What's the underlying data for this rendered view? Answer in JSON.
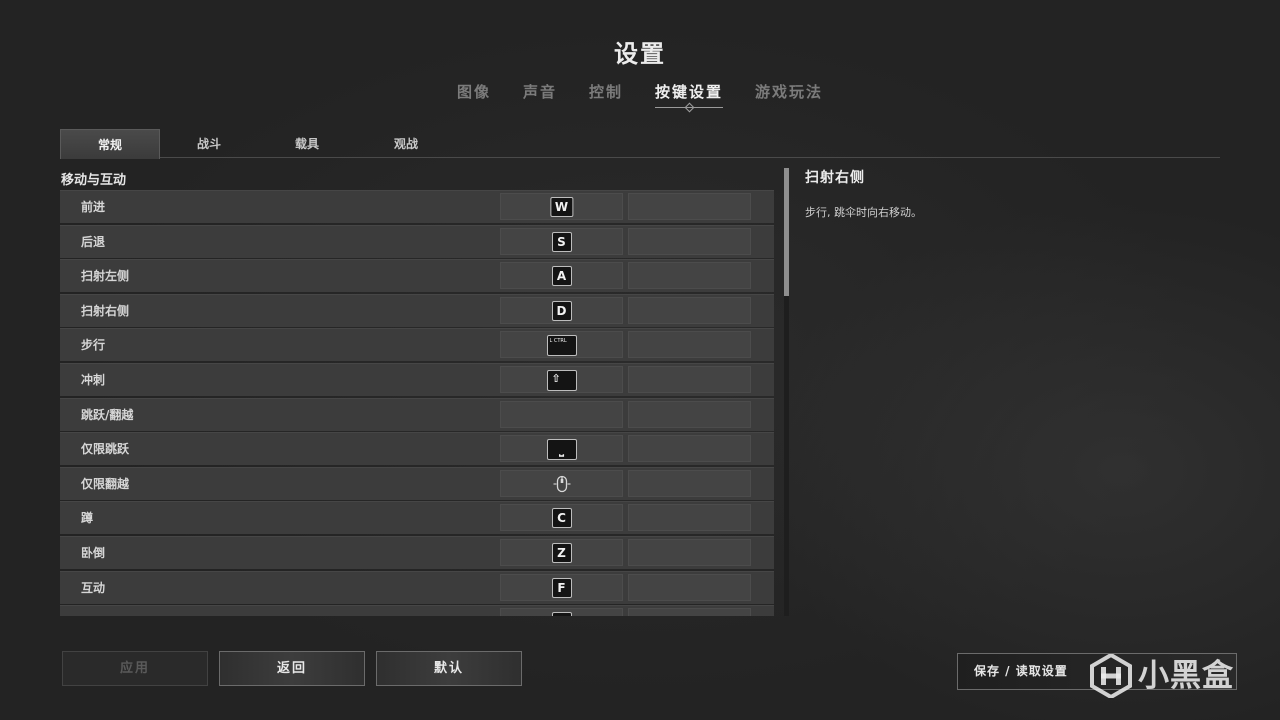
{
  "header": {
    "title": "设置",
    "tabs": [
      {
        "label": "图像",
        "active": false
      },
      {
        "label": "声音",
        "active": false
      },
      {
        "label": "控制",
        "active": false
      },
      {
        "label": "按键设置",
        "active": true
      },
      {
        "label": "游戏玩法",
        "active": false
      }
    ]
  },
  "sub_tabs": [
    {
      "label": "常规",
      "active": true
    },
    {
      "label": "战斗",
      "active": false
    },
    {
      "label": "载具",
      "active": false
    },
    {
      "label": "观战",
      "active": false
    }
  ],
  "section": {
    "heading": "移动与互动",
    "rows": [
      {
        "label": "前进",
        "primary_key": "W",
        "primary_icon": "key",
        "secondary_key": ""
      },
      {
        "label": "后退",
        "primary_key": "S",
        "primary_icon": "key",
        "secondary_key": ""
      },
      {
        "label": "扫射左侧",
        "primary_key": "A",
        "primary_icon": "key",
        "secondary_key": ""
      },
      {
        "label": "扫射右侧",
        "primary_key": "D",
        "primary_icon": "key",
        "secondary_key": ""
      },
      {
        "label": "步行",
        "primary_key": "L CTRL",
        "primary_icon": "wide-key",
        "secondary_key": ""
      },
      {
        "label": "冲刺",
        "primary_key": "⇧",
        "primary_icon": "shift-key",
        "secondary_key": ""
      },
      {
        "label": "跳跃/翻越",
        "primary_key": "",
        "primary_icon": "none",
        "secondary_key": ""
      },
      {
        "label": "仅限跳跃",
        "primary_key": "⎵",
        "primary_icon": "space-key",
        "secondary_key": ""
      },
      {
        "label": "仅限翻越",
        "primary_key": "",
        "primary_icon": "mouse-icon",
        "secondary_key": ""
      },
      {
        "label": "蹲",
        "primary_key": "C",
        "primary_icon": "key",
        "secondary_key": ""
      },
      {
        "label": "卧倒",
        "primary_key": "Z",
        "primary_icon": "key",
        "secondary_key": ""
      },
      {
        "label": "互动",
        "primary_key": "F",
        "primary_icon": "key",
        "secondary_key": ""
      },
      {
        "label": "",
        "primary_key": "",
        "primary_icon": "key",
        "secondary_key": ""
      }
    ]
  },
  "scrollbar": {
    "scroll_fraction": 0.0
  },
  "detail": {
    "title": "扫射右侧",
    "description": "步行, 跳伞时向右移动。"
  },
  "footer": {
    "apply_label": "应用",
    "back_label": "返回",
    "default_label": "默认",
    "save_load_label": "保存 / 读取设置"
  },
  "watermark": {
    "text": "小黑盒"
  },
  "colors": {
    "background": "#262626",
    "row": "#3c3c3c",
    "slot": "#444444",
    "keycap": "#141414",
    "text_primary": "#ececec",
    "text_muted": "#7b7b7b"
  }
}
